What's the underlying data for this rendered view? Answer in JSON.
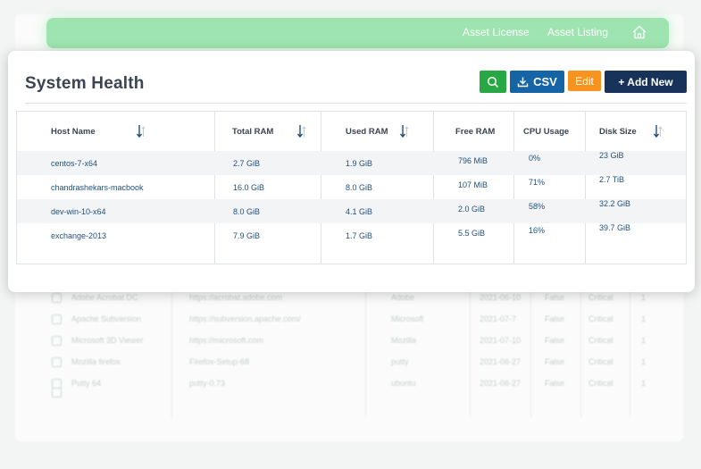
{
  "nav": {
    "links": [
      "Asset License",
      "Asset Listing"
    ],
    "home_icon": "home-icon"
  },
  "card": {
    "title": "System Health",
    "toolbar": {
      "search_icon": "search-icon",
      "csv_label": "CSV",
      "csv_icon": "download-icon",
      "edit_label": "Edit",
      "add_label": "+ Add New"
    },
    "columns": [
      "Host Name",
      "Total RAM",
      "Used RAM",
      "Free RAM",
      "CPU Usage",
      "Disk Size"
    ],
    "rows": [
      {
        "host": "centos-7-x64",
        "total": "2.7 GiB",
        "used": "1.9 GiB",
        "free": "796 MiB",
        "cpu": "0%",
        "disk": "23 GiB"
      },
      {
        "host": "chandrashekars-macbook",
        "total": "16.0 GiB",
        "used": "8.0 GiB",
        "free": "107 MiB",
        "cpu": "71%",
        "disk": "2.7 TiB"
      },
      {
        "host": "dev-win-10-x64",
        "total": "8.0 GiB",
        "used": "4.1 GiB",
        "free": "2.0 GiB",
        "cpu": "58%",
        "disk": "32.2 GiB"
      },
      {
        "host": "exchange-2013",
        "total": "7.9 GiB",
        "used": "1.7 GiB",
        "free": "5.5 GiB",
        "cpu": "16%",
        "disk": "39.7 GiB"
      }
    ]
  },
  "background_rows": [
    {
      "name": "Adobe Acrobat DC",
      "url": "https://acrobat.adobe.com",
      "vendor": "Adobe",
      "date": "2021-06-10",
      "flag": "False",
      "status": "Critical",
      "count": "1"
    },
    {
      "name": "Apache Subversion",
      "url": "https://subversion.apache.com/",
      "vendor": "Microsoft",
      "date": "2021-07-7",
      "flag": "False",
      "status": "Critical",
      "count": "1"
    },
    {
      "name": "Microsoft 3D Viewer",
      "url": "https://microsoft.com",
      "vendor": "Mozilla",
      "date": "2021-07-10",
      "flag": "False",
      "status": "Critical",
      "count": "1"
    },
    {
      "name": "Mozilla firefox",
      "url": "Firefox-Setup-68",
      "vendor": "putty",
      "date": "2021-06-27",
      "flag": "False",
      "status": "Critical",
      "count": "1"
    },
    {
      "name": "Putty 64",
      "url": "putty-0.73",
      "vendor": "ubuntu",
      "date": "2021-06-27",
      "flag": "False",
      "status": "Critical",
      "count": "1"
    }
  ],
  "colors": {
    "nav": "#8ee0a4",
    "search": "#28a745",
    "csv": "#1565a6",
    "edit": "#f7931e",
    "add": "#17335a",
    "link": "#1f4f7a"
  }
}
